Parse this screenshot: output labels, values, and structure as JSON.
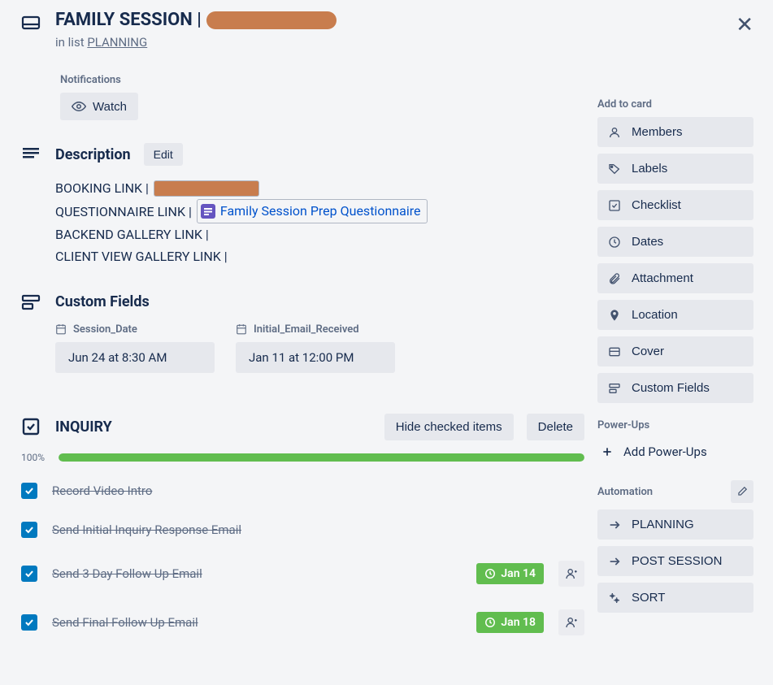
{
  "header": {
    "title_prefix": "FAMILY SESSION |",
    "in_list_prefix": "in list",
    "list_name": "PLANNING"
  },
  "notifications": {
    "label": "Notifications",
    "watch_label": "Watch"
  },
  "description": {
    "title": "Description",
    "edit_label": "Edit",
    "lines": {
      "booking": "BOOKING LINK |",
      "questionnaire": "QUESTIONNAIRE LINK |",
      "questionnaire_chip": "Family Session Prep Questionnaire",
      "backend": "BACKEND GALLERY LINK |",
      "client": "CLIENT VIEW GALLERY LINK |"
    }
  },
  "custom_fields": {
    "title": "Custom Fields",
    "items": [
      {
        "label": "Session_Date",
        "value": "Jun 24 at 8:30 AM"
      },
      {
        "label": "Initial_Email_Received",
        "value": "Jan 11 at 12:00 PM"
      }
    ]
  },
  "checklist": {
    "title": "INQUIRY",
    "hide_label": "Hide checked items",
    "delete_label": "Delete",
    "progress_pct": "100%",
    "progress_value": 100,
    "items": [
      {
        "text": "Record Video Intro",
        "checked": true,
        "due": null
      },
      {
        "text": "Send Initial Inquiry Response Email",
        "checked": true,
        "due": null
      },
      {
        "text": "Send 3 Day Follow Up Email",
        "checked": true,
        "due": "Jan 14"
      },
      {
        "text": "Send Final Follow Up Email",
        "checked": true,
        "due": "Jan 18"
      }
    ]
  },
  "sidebar": {
    "add_to_card": "Add to card",
    "items": {
      "members": "Members",
      "labels": "Labels",
      "checklist": "Checklist",
      "dates": "Dates",
      "attachment": "Attachment",
      "location": "Location",
      "cover": "Cover",
      "custom_fields": "Custom Fields"
    },
    "powerups_title": "Power-Ups",
    "add_powerups": "Add Power-Ups",
    "automation_title": "Automation",
    "automations": {
      "planning": "PLANNING",
      "post_session": "POST SESSION",
      "sort": "SORT"
    }
  }
}
